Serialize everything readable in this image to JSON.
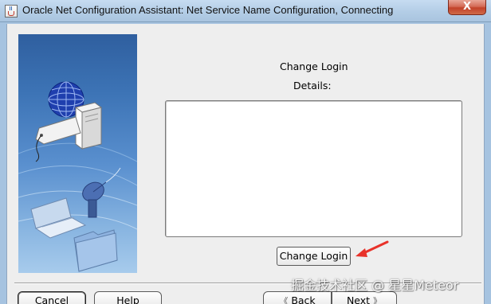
{
  "window": {
    "title": "Oracle Net Configuration Assistant: Net Service Name Configuration, Connecting",
    "close_glyph": "X",
    "app_icon": "java-cup-icon"
  },
  "main": {
    "heading": "Change Login",
    "details_label": "Details:",
    "details_text": "",
    "change_login_button": "Change Login"
  },
  "footer": {
    "cancel_label": "Cancel",
    "help_label": "Help",
    "back_label": "Back",
    "next_label": "Next",
    "back_glyph": "《",
    "next_glyph": "》"
  },
  "watermark": "掘金技术社区 @ 星星Meteor",
  "colors": {
    "annotation_arrow": "#e8322a",
    "title_bar": "#b3cde6",
    "close_button": "#c2422a"
  }
}
